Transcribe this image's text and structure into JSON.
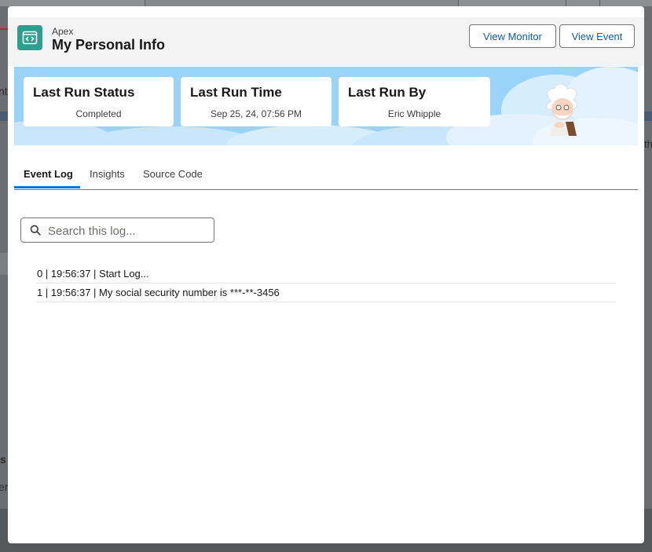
{
  "header": {
    "eyebrow": "Apex",
    "title": "My Personal Info",
    "buttons": {
      "view_monitor": "View Monitor",
      "view_event": "View Event"
    }
  },
  "stats": [
    {
      "title": "Last Run Status",
      "value": "Completed"
    },
    {
      "title": "Last Run Time",
      "value": "Sep 25, 24, 07:56 PM"
    },
    {
      "title": "Last Run By",
      "value": "Eric Whipple"
    }
  ],
  "tabs": [
    {
      "label": "Event Log",
      "active": true
    },
    {
      "label": "Insights",
      "active": false
    },
    {
      "label": "Source Code",
      "active": false
    }
  ],
  "search": {
    "placeholder": "Search this log...",
    "value": ""
  },
  "log": [
    "0 | 19:56:37 | Start Log...",
    "1 | 19:56:37 | My social security number is ***-**-3456"
  ],
  "background": {
    "left_fragment_1": "nt",
    "left_fragment_2": "s",
    "left_fragment_3": "er",
    "right_fragment": "th"
  },
  "colors": {
    "accent": "#0176d3",
    "button_text": "#0b5cab",
    "app_icon": "#2e9e8f",
    "banner_sky": "#9ad3f8"
  },
  "icons": {
    "app": "code-window-icon",
    "search": "search-icon",
    "mascot": "einstein-mascot"
  }
}
